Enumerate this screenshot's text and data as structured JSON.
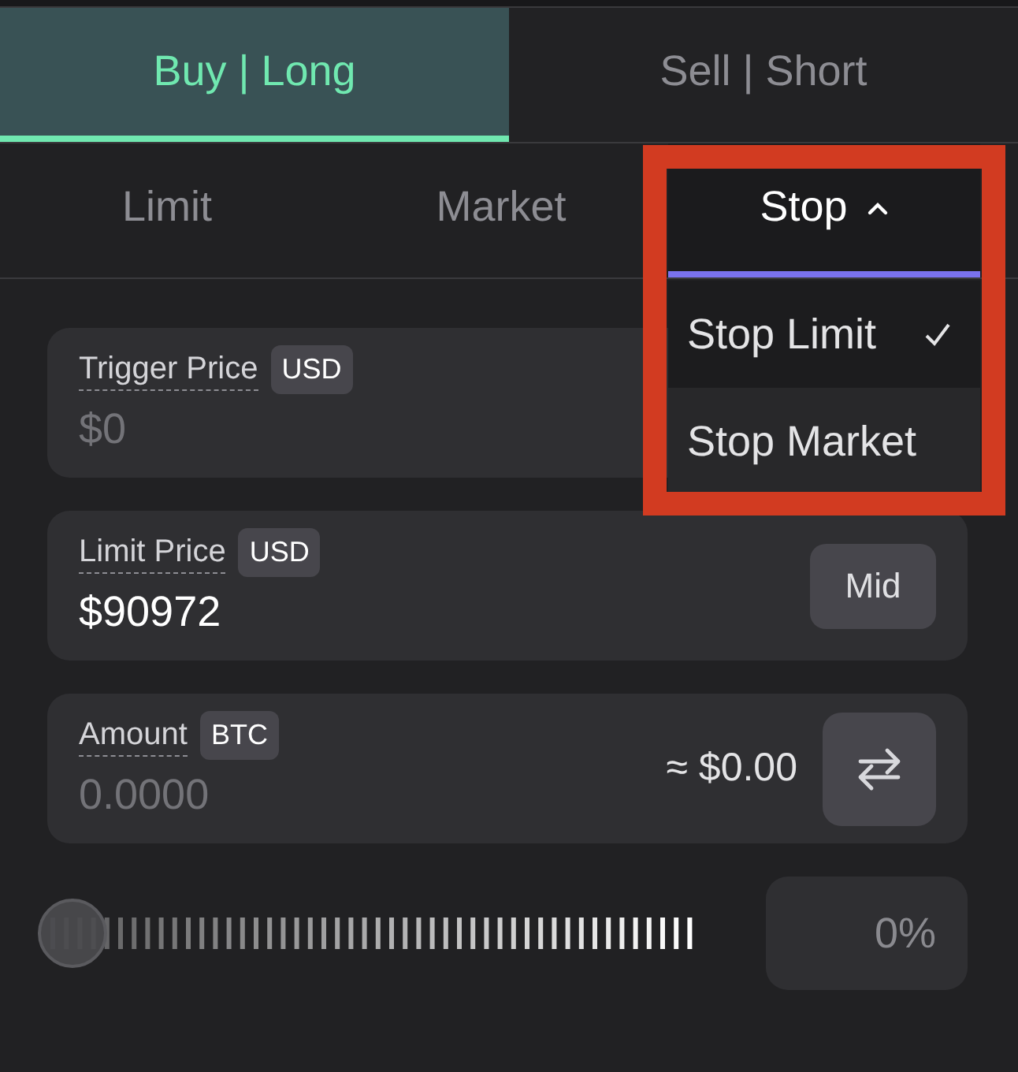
{
  "side_tabs": [
    {
      "label": "Buy | Long",
      "selected": true
    },
    {
      "label": "Sell | Short",
      "selected": false
    }
  ],
  "order_tabs": [
    {
      "label": "Limit",
      "selected": false,
      "expanded": false
    },
    {
      "label": "Market",
      "selected": false,
      "expanded": false
    },
    {
      "label": "Stop",
      "selected": true,
      "expanded": true
    }
  ],
  "dropdown": {
    "items": [
      {
        "label": "Stop Limit",
        "selected": true
      },
      {
        "label": "Stop Market",
        "selected": false
      }
    ]
  },
  "fields": [
    {
      "label": "Trigger Price",
      "unit": "USD",
      "placeholder": "$0"
    },
    {
      "label": "Limit Price",
      "unit": "USD",
      "value": "$90972",
      "button": "Mid"
    },
    {
      "label": "Amount",
      "unit": "BTC",
      "placeholder": "0.0000",
      "estimate": "≈ $0.00"
    }
  ],
  "slider": {
    "level": 0,
    "placeholder": "0%"
  }
}
